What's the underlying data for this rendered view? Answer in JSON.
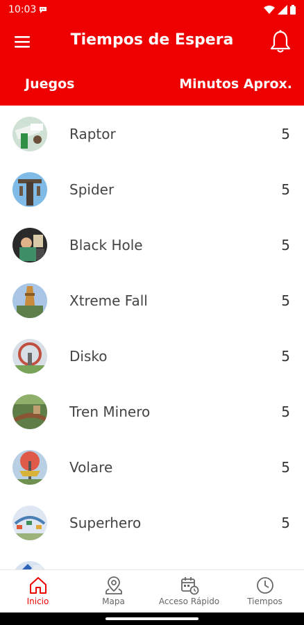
{
  "status": {
    "time": "10:03"
  },
  "header": {
    "title": "Tiempos de Espera"
  },
  "columns": {
    "rides": "Juegos",
    "minutes": "Minutos Aprox."
  },
  "rides": [
    {
      "name": "Raptor",
      "wait": "5"
    },
    {
      "name": "Spider",
      "wait": "5"
    },
    {
      "name": "Black Hole",
      "wait": "5"
    },
    {
      "name": "Xtreme Fall",
      "wait": "5"
    },
    {
      "name": "Disko",
      "wait": "5"
    },
    {
      "name": "Tren Minero",
      "wait": "5"
    },
    {
      "name": "Volare",
      "wait": "5"
    },
    {
      "name": "Superhero",
      "wait": "5"
    },
    {
      "name": "",
      "wait": ""
    }
  ],
  "nav": [
    {
      "label": "Inicio",
      "icon": "home-icon",
      "active": true
    },
    {
      "label": "Mapa",
      "icon": "map-pin-icon",
      "active": false
    },
    {
      "label": "Acceso Rápido",
      "icon": "calendar-clock-icon",
      "active": false
    },
    {
      "label": "Tiempos",
      "icon": "clock-icon",
      "active": false
    }
  ],
  "colors": {
    "brand": "#ee0000",
    "text": "#444444",
    "inactive": "#666666"
  }
}
